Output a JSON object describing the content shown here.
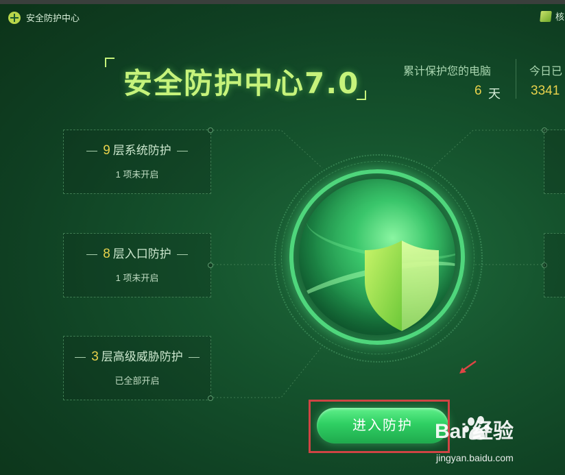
{
  "app": {
    "title": "安全防护中心",
    "core_tab_label": "核"
  },
  "hero": {
    "title": "安全防护中心7.0"
  },
  "stats": {
    "protect_label": "累计保护您的电脑",
    "protect_value": "6",
    "protect_unit": "天",
    "today_label": "今日已",
    "today_value": "3341"
  },
  "cards": [
    {
      "num": "9",
      "label": "层系统防护",
      "status": "1 项未开启"
    },
    {
      "num": "8",
      "label": "层入口防护",
      "status": "1 项未开启"
    },
    {
      "num": "3",
      "label": "层高级威胁防护",
      "status": "已全部开启"
    }
  ],
  "enter_button": {
    "label": "进入防护"
  },
  "watermark": {
    "brand": "Bai 经验",
    "url": "jingyan.baidu.com"
  },
  "colors": {
    "accent_green": "#2fcf63",
    "highlight_red": "#d04444",
    "value_yellow": "#e8d24c"
  }
}
